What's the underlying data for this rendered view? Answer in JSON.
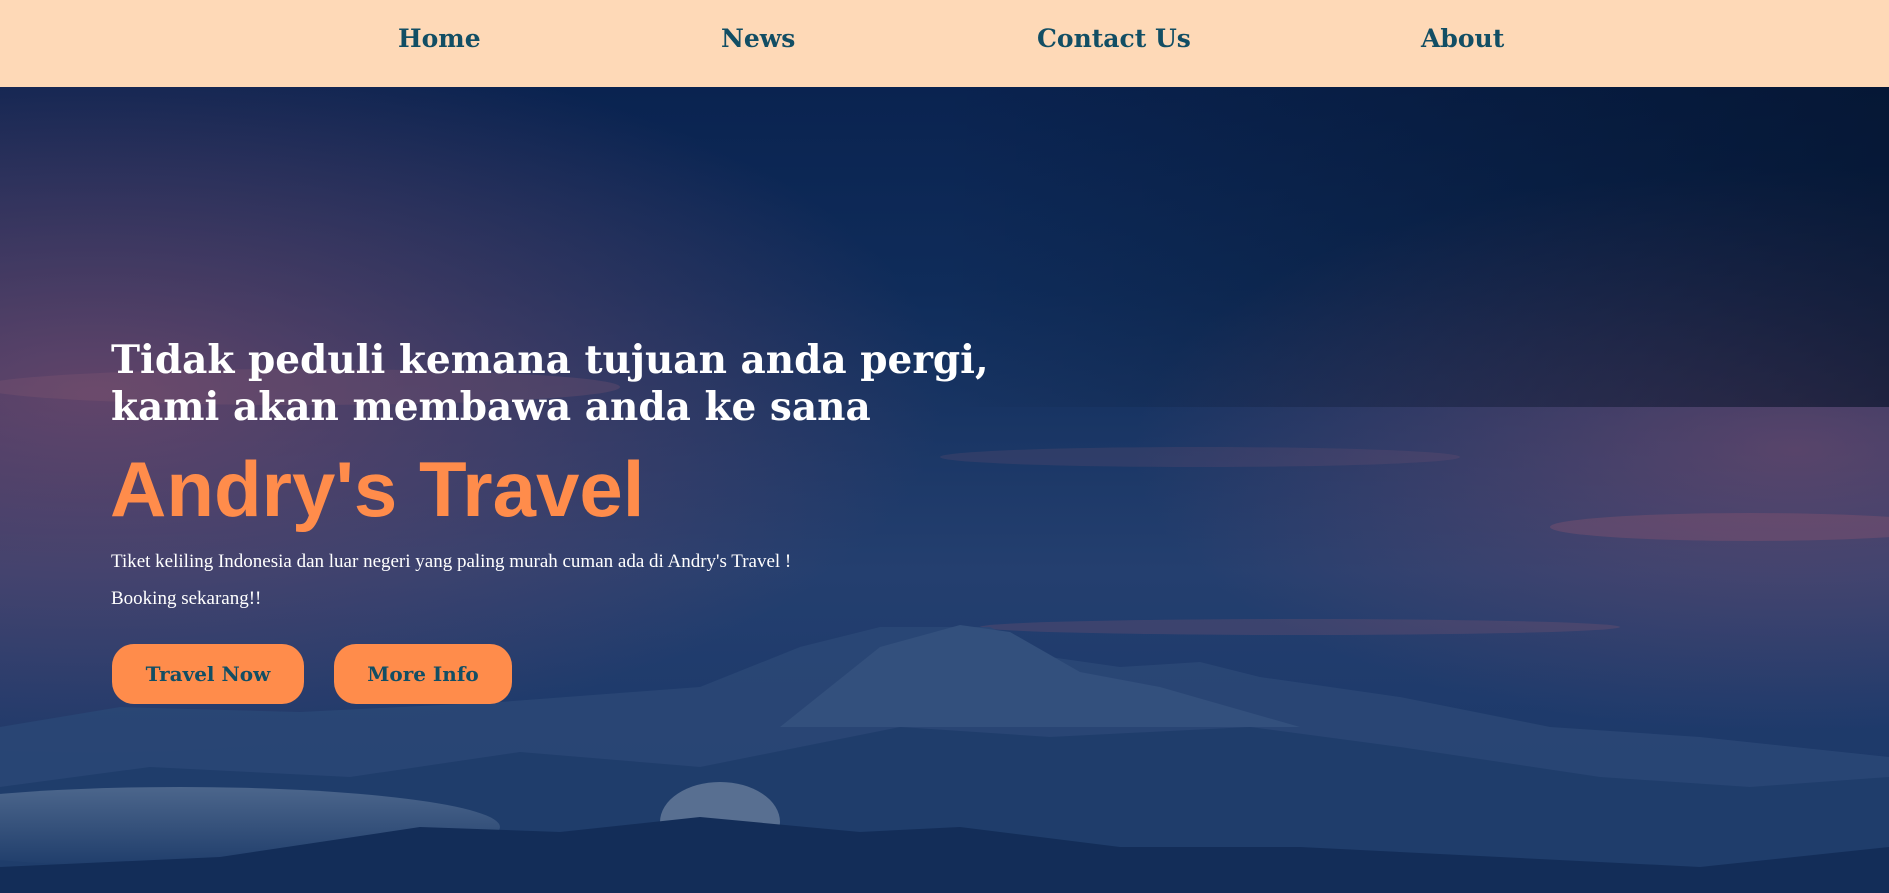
{
  "nav": {
    "items": [
      {
        "label": "Home"
      },
      {
        "label": "News"
      },
      {
        "label": "Contact Us"
      },
      {
        "label": "About"
      }
    ]
  },
  "hero": {
    "tagline_line1": "Tidak peduli kemana tujuan anda pergi,",
    "tagline_line2": "kami akan membawa anda ke sana",
    "brand": "Andry's Travel",
    "description_line1": "Tiket keliling Indonesia dan luar negeri yang paling murah cuman ada di Andry's Travel !",
    "description_line2": "Booking sekarang!!",
    "buttons": {
      "travel_now": "Travel Now",
      "more_info": "More Info"
    }
  },
  "colors": {
    "nav_background": "#fed9b7",
    "nav_text": "#124e64",
    "accent": "#ff8c4b",
    "hero_text": "#ffffff"
  }
}
